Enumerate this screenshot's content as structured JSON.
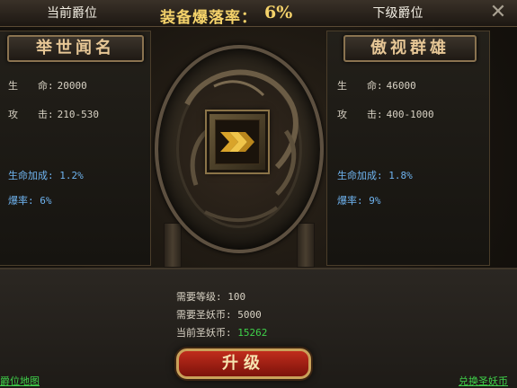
{
  "header": {
    "current_rank_label": "当前爵位",
    "drop_rate_label": "装备爆落率：",
    "drop_rate_value": "6%",
    "next_rank_label": "下级爵位",
    "close_glyph": "✕"
  },
  "current": {
    "title": "举世闻名",
    "hp_label": "生　　命:",
    "hp_value": "20000",
    "atk_label": "攻　　击:",
    "atk_value": "210-530",
    "bonus_label": "生命加成:",
    "bonus_value": "1.2%",
    "drop_label": "爆率:",
    "drop_value": "6%"
  },
  "next": {
    "title": "傲视群雄",
    "hp_label": "生　　命:",
    "hp_value": "46000",
    "atk_label": "攻　　击:",
    "atk_value": "400-1000",
    "bonus_label": "生命加成:",
    "bonus_value": "1.8%",
    "drop_label": "爆率:",
    "drop_value": "9%"
  },
  "requirements": {
    "level_label": "需要等级:",
    "level_value": "100",
    "coin_label": "需要圣妖币:",
    "coin_value": "5000",
    "current_coin_label": "当前圣妖币:",
    "current_coin_value": "15262"
  },
  "footer": {
    "upgrade_label": "升级",
    "left_link": "爵位地图",
    "right_link": "兑换圣妖币"
  },
  "colors": {
    "gold": "#f4d26a",
    "blue_stat": "#6fb4f0",
    "green": "#3fd14a",
    "button_red": "#c02c1c"
  },
  "icons": {
    "emblem": "chevron-rank-icon",
    "close": "close-icon"
  }
}
